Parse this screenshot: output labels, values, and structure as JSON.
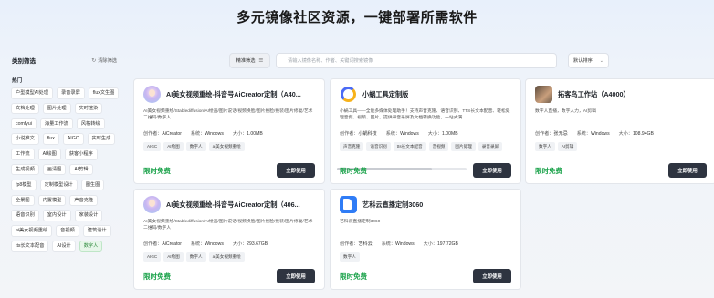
{
  "page_title": "多元镜像社区资源，一键部署所需软件",
  "sidebar": {
    "title": "类别筛选",
    "clear_label": "清除筛选",
    "hot_label": "热门",
    "tags": [
      {
        "label": "户型模型AI处理",
        "active": false
      },
      {
        "label": "录音录屏",
        "active": false
      },
      {
        "label": "flux文生图",
        "active": false
      },
      {
        "label": "文档处理",
        "active": false
      },
      {
        "label": "图片处理",
        "active": false
      },
      {
        "label": "实时渲染",
        "active": false
      },
      {
        "label": "comfyui",
        "active": false
      },
      {
        "label": "海量工作流",
        "active": false
      },
      {
        "label": "风格转绘",
        "active": false
      },
      {
        "label": "小说推文",
        "active": false
      },
      {
        "label": "flux",
        "active": false
      },
      {
        "label": "AIGC",
        "active": false
      },
      {
        "label": "实时生成",
        "active": false
      },
      {
        "label": "工作流",
        "active": false
      },
      {
        "label": "AI绘图",
        "active": false
      },
      {
        "label": "获客小程序",
        "active": false
      },
      {
        "label": "生成视频",
        "active": false
      },
      {
        "label": "画清图",
        "active": false
      },
      {
        "label": "AI剪辑",
        "active": false
      },
      {
        "label": "fp8模型",
        "active": false
      },
      {
        "label": "定制模型设计",
        "active": false
      },
      {
        "label": "图生图",
        "active": false
      },
      {
        "label": "全景图",
        "active": false
      },
      {
        "label": "内置模型",
        "active": false
      },
      {
        "label": "声音克隆",
        "active": false
      },
      {
        "label": "语音识别",
        "active": false
      },
      {
        "label": "室内设计",
        "active": false
      },
      {
        "label": "家装设计",
        "active": false
      },
      {
        "label": "ai美女视频重绘",
        "active": false
      },
      {
        "label": "音视频",
        "active": false
      },
      {
        "label": "建筑设计",
        "active": false
      },
      {
        "label": "tts长文本配音",
        "active": false
      },
      {
        "label": "AI设计",
        "active": false
      },
      {
        "label": "数字人",
        "active": true
      }
    ]
  },
  "toolbar": {
    "filter_label": "精准筛选",
    "filter_icon": "filter-icon",
    "search_placeholder": "请输入镜像名称、作者、关键词搜索镜像",
    "sort_label": "默认排序",
    "sort_icon": "chevron-down-icon"
  },
  "labels": {
    "author": "创作者：",
    "system": "系统：",
    "size": "大小：",
    "price": "限时免费",
    "use_button": "立即使用"
  },
  "cards": [
    {
      "title": "AI美女视频重绘-抖音号AiCreator定制（A40...",
      "desc": "AI美女视频重绘/Stablediffusion/AI绘画/图片说话/视频换脸/图片换脸/换装/图片修复/艺术二维码/数字人",
      "author": "AiCreator",
      "system": "Windows",
      "size": "1.00MB",
      "tags": [
        "AIGC",
        "AI绘图",
        "数字人",
        "ai美女视频重绘"
      ]
    },
    {
      "title": "小蜗工具定制版",
      "desc": "小蜗工具——全能多媒体处理助手！支持声音克隆、语音识别、TTS长文本配音、轻松处理音频、视频、图片，提供录音录屏及文档转换功能，一站式满…",
      "author": "小蜗科技",
      "system": "Windows",
      "size": "1.00MB",
      "tags": [
        "声音克隆",
        "语音识别",
        "tts长文本配音",
        "音视频",
        "图片处理",
        "录音录屏"
      ]
    },
    {
      "title": "拓客鸟工作站（A4000）",
      "desc": "数字人直播，数字人力，AI剪辑",
      "author": "张无忌",
      "system": "Windows",
      "size": "108.94GB",
      "tags": [
        "数字人",
        "AI剪辑"
      ]
    },
    {
      "title": "AI美女视频重绘-抖音号AiCreator定制（406...",
      "desc": "AI美女视频重绘/Stablediffusion/AI绘画/图片说话/视频换脸/图片换脸/换装/图片修复/艺术二维码/数字人",
      "author": "AiCreator",
      "system": "Windows",
      "size": "293.67GB",
      "tags": [
        "AIGC",
        "AI绘图",
        "数字人",
        "ai美女视频重绘"
      ]
    },
    {
      "title": "艺科云直播定制3060",
      "desc": "艺科云直播定制3060",
      "author": "艺科云",
      "system": "Windows",
      "size": "197.72GB",
      "tags": [
        "数字人"
      ]
    }
  ]
}
